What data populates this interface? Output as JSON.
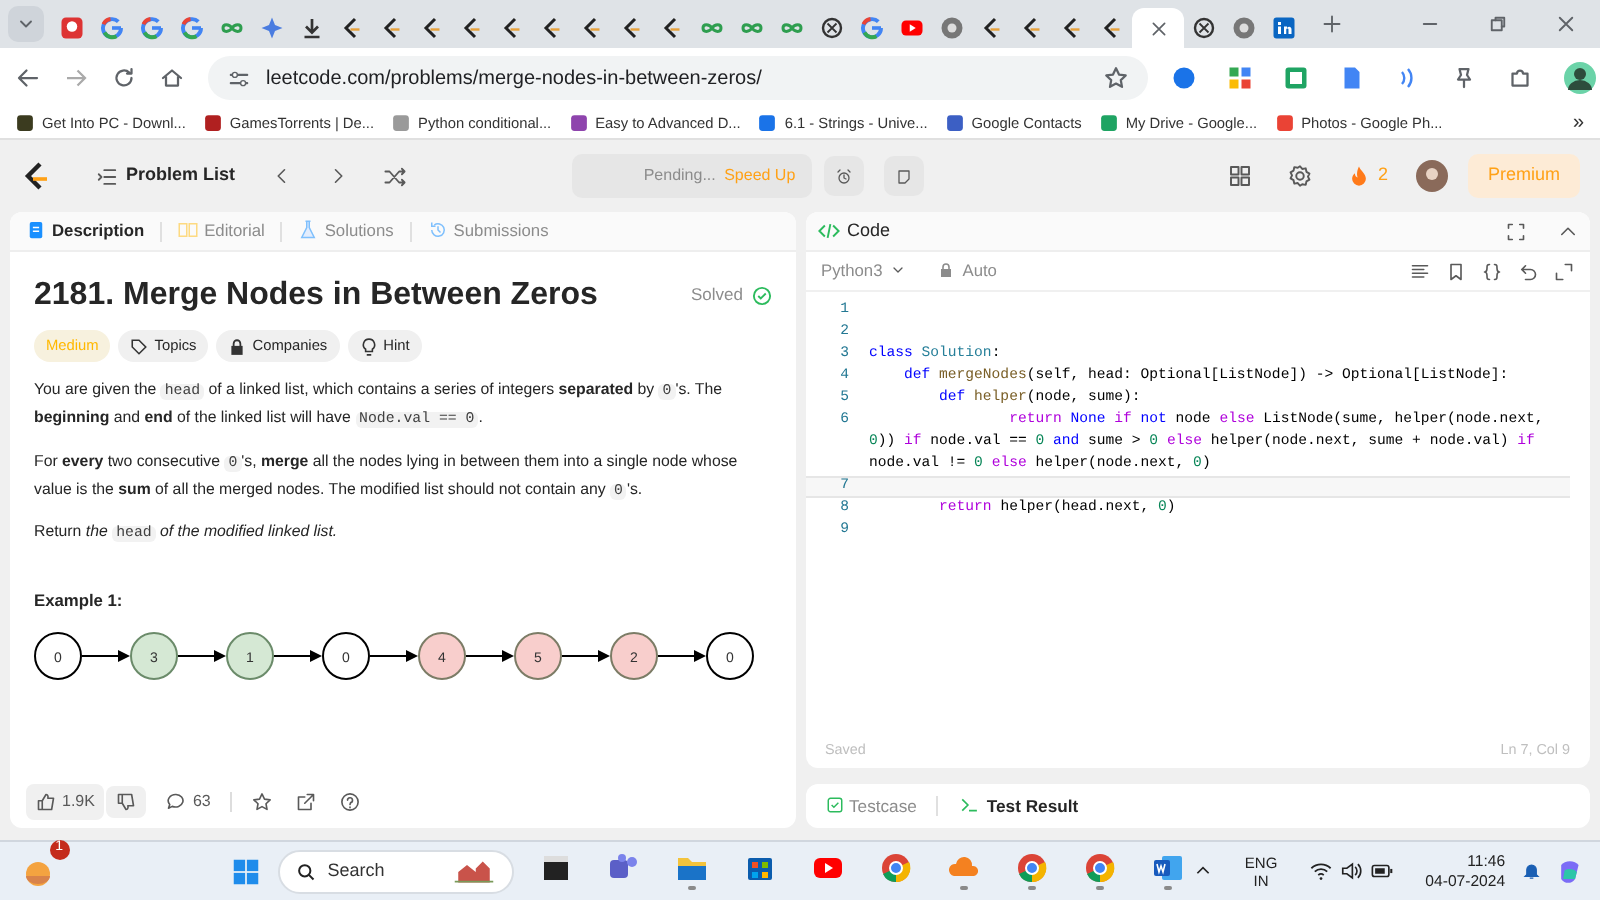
{
  "browser": {
    "tabs": [
      {
        "kind": "red",
        "selected": false
      },
      {
        "kind": "google",
        "selected": false
      },
      {
        "kind": "google",
        "selected": false
      },
      {
        "kind": "google",
        "selected": false
      },
      {
        "kind": "infinity",
        "selected": false
      },
      {
        "kind": "sparkle",
        "selected": false
      },
      {
        "kind": "download",
        "selected": false
      },
      {
        "kind": "leetcode",
        "selected": false
      },
      {
        "kind": "leetcode",
        "selected": false
      },
      {
        "kind": "leetcode",
        "selected": false
      },
      {
        "kind": "leetcode",
        "selected": false
      },
      {
        "kind": "leetcode",
        "selected": false
      },
      {
        "kind": "leetcode",
        "selected": false
      },
      {
        "kind": "leetcode",
        "selected": false
      },
      {
        "kind": "leetcode",
        "selected": false
      },
      {
        "kind": "leetcode",
        "selected": false
      },
      {
        "kind": "infinity",
        "selected": false
      },
      {
        "kind": "infinity",
        "selected": false
      },
      {
        "kind": "infinity",
        "selected": false
      },
      {
        "kind": "knot",
        "selected": false
      },
      {
        "kind": "google",
        "selected": false
      },
      {
        "kind": "youtube",
        "selected": false
      },
      {
        "kind": "chrome",
        "selected": false
      },
      {
        "kind": "leetcode",
        "selected": false
      },
      {
        "kind": "leetcode",
        "selected": false
      },
      {
        "kind": "leetcode",
        "selected": false
      },
      {
        "kind": "leetcode",
        "selected": false
      },
      {
        "selected": true
      },
      {
        "kind": "knot",
        "selected": false
      },
      {
        "kind": "chrome",
        "selected": false
      },
      {
        "kind": "linkedin",
        "selected": false
      }
    ],
    "url": "leetcode.com/problems/merge-nodes-in-between-zeros/",
    "bookmarks": [
      {
        "label": "Get Into PC - Downl...",
        "color": "#3b3b1f"
      },
      {
        "label": "GamesTorrents | De...",
        "color": "#b02020"
      },
      {
        "label": "Python conditional...",
        "color": "#9a9a9a"
      },
      {
        "label": "Easy to Advanced D...",
        "color": "#8e44ad"
      },
      {
        "label": "6.1 - Strings - Unive...",
        "color": "#1a73e8"
      },
      {
        "label": "Google Contacts",
        "color": "#3c5fc4"
      },
      {
        "label": "My Drive - Google...",
        "color": "#1fa463"
      },
      {
        "label": "Photos - Google Ph...",
        "color": "#ea4335"
      }
    ],
    "more": "»"
  },
  "header": {
    "problem_list": "Problem List",
    "pending": "Pending...",
    "speed_up": "Speed Up",
    "streak": "2",
    "premium": "Premium"
  },
  "left": {
    "tabs": [
      {
        "label": "Description",
        "selected": true
      },
      {
        "label": "Editorial",
        "selected": false
      },
      {
        "label": "Solutions",
        "selected": false
      },
      {
        "label": "Submissions",
        "selected": false
      }
    ],
    "title": "2181. Merge Nodes in Between Zeros",
    "status": "Solved",
    "tags": [
      {
        "label": "Medium",
        "kind": "difficulty"
      },
      {
        "label": "Topics",
        "kind": "topics"
      },
      {
        "label": "Companies",
        "kind": "companies"
      },
      {
        "label": "Hint",
        "kind": "hint"
      }
    ],
    "paragraphs": [
      [
        {
          "text": "You are given the ",
          "code": false
        },
        {
          "text": "head",
          "code": true
        },
        {
          "text": " of a linked list, which contains a series of integers **separated** by ",
          "code": false
        },
        {
          "text": "0",
          "code": true
        },
        {
          "text": "'s. The **beginning** and **end** of the linked list will have ",
          "code": false
        },
        {
          "text": "Node.val == 0",
          "code": true
        },
        {
          "text": ".",
          "code": false
        }
      ],
      [
        {
          "text": "For **every** two consecutive ",
          "code": false
        },
        {
          "text": "0",
          "code": true
        },
        {
          "text": "'s, **merge** all the nodes lying in between them into a single node whose value is the **sum** of all the merged nodes. The modified list should not contain any ",
          "code": false
        },
        {
          "text": "0",
          "code": true
        },
        {
          "text": "'s.",
          "code": false
        }
      ],
      [
        {
          "text": "Return *the* ",
          "code": false
        },
        {
          "text": "head",
          "code": true
        },
        {
          "text": " *of the modified linked list.*",
          "code": false
        }
      ]
    ],
    "example_title": "Example 1:",
    "nodes": [
      {
        "label": "0",
        "color": "#ffffff"
      },
      {
        "label": "3",
        "color": "#d5e8d4"
      },
      {
        "label": "1",
        "color": "#d5e8d4"
      },
      {
        "label": "0",
        "color": "#ffffff"
      },
      {
        "label": "4",
        "color": "#f8cecc"
      },
      {
        "label": "5",
        "color": "#f8cecc"
      },
      {
        "label": "2",
        "color": "#f8cecc"
      },
      {
        "label": "0",
        "color": "#ffffff"
      }
    ],
    "likes": "1.9K",
    "comments": "63"
  },
  "editor": {
    "title": "Code",
    "language": "Python3",
    "mode": "Auto",
    "lines": [
      {
        "number": "1",
        "current": false
      },
      {
        "number": "2",
        "current": false
      },
      {
        "number": "3",
        "current": false,
        "tokens": [
          {
            "text": "class",
            "kind": "kw"
          },
          {
            "text": " Solution",
            "kind": "cls"
          },
          {
            "text": ":",
            "kind": "plain"
          }
        ]
      },
      {
        "number": "4",
        "current": false,
        "tokens": [
          {
            "text": "    def",
            "kind": "kw"
          },
          {
            "text": " mergeNodes",
            "kind": "fn"
          },
          {
            "text": "(self, head: Optional[ListNode]) -> Optional[ListNode]:",
            "kind": "plain"
          }
        ]
      },
      {
        "number": "5",
        "current": false,
        "tokens": [
          {
            "text": "        def",
            "kind": "kw"
          },
          {
            "text": " helper",
            "kind": "fn"
          },
          {
            "text": "(node, sume):",
            "kind": "plain"
          }
        ]
      },
      {
        "number": "6",
        "current": false,
        "tokens": [
          {
            "text": "                return",
            "kind": "ctl"
          },
          {
            "text": " None",
            "kind": "kw"
          },
          {
            "text": " if",
            "kind": "ctl"
          },
          {
            "text": " not",
            "kind": "kw"
          },
          {
            "text": " node ",
            "kind": "plain"
          },
          {
            "text": "else",
            "kind": "ctl"
          },
          {
            "text": " ListNode(sume, helper(node.next, ",
            "kind": "plain"
          },
          {
            "text": "0",
            "kind": "num"
          },
          {
            "text": ")) ",
            "kind": "plain"
          },
          {
            "text": "if",
            "kind": "ctl"
          },
          {
            "text": " node.val == ",
            "kind": "plain"
          },
          {
            "text": "0",
            "kind": "num"
          },
          {
            "text": " and",
            "kind": "kw"
          },
          {
            "text": " sume > ",
            "kind": "plain"
          },
          {
            "text": "0",
            "kind": "num"
          },
          {
            "text": " else",
            "kind": "ctl"
          },
          {
            "text": " helper(node.next, sume + node.val) ",
            "kind": "plain"
          },
          {
            "text": "if",
            "kind": "ctl"
          },
          {
            "text": " node.val != ",
            "kind": "plain"
          },
          {
            "text": "0",
            "kind": "num"
          },
          {
            "text": " else",
            "kind": "ctl"
          },
          {
            "text": " helper(node.next, ",
            "kind": "plain"
          },
          {
            "text": "0",
            "kind": "num"
          },
          {
            "text": ")",
            "kind": "plain"
          }
        ]
      },
      {
        "number": "7",
        "current": true
      },
      {
        "number": "8",
        "current": false,
        "tokens": [
          {
            "text": "        return",
            "kind": "ctl"
          },
          {
            "text": " helper(head.next, ",
            "kind": "plain"
          },
          {
            "text": "0",
            "kind": "num"
          },
          {
            "text": ")",
            "kind": "plain"
          }
        ]
      },
      {
        "number": "9",
        "current": false
      }
    ],
    "saved": "Saved",
    "cursor": "Ln 7, Col 9"
  },
  "bottom_tabs": [
    {
      "label": "Testcase",
      "selected": false
    },
    {
      "label": "Test Result",
      "selected": true
    }
  ],
  "taskbar": {
    "weather_badge": "1",
    "search_label": "Search",
    "apps": [
      {
        "kind": "terminal",
        "open": false
      },
      {
        "kind": "teams",
        "open": false
      },
      {
        "kind": "folder",
        "open": true
      },
      {
        "kind": "store",
        "open": false
      },
      {
        "kind": "youtube",
        "open": false
      },
      {
        "kind": "chrome",
        "open": false
      },
      {
        "kind": "cloud",
        "open": true
      },
      {
        "kind": "chrome",
        "open": true
      },
      {
        "kind": "chrome",
        "open": true
      },
      {
        "kind": "word",
        "open": true
      }
    ],
    "language": "ENG",
    "region": "IN",
    "time": "11:46",
    "date": "04-07-2024"
  }
}
